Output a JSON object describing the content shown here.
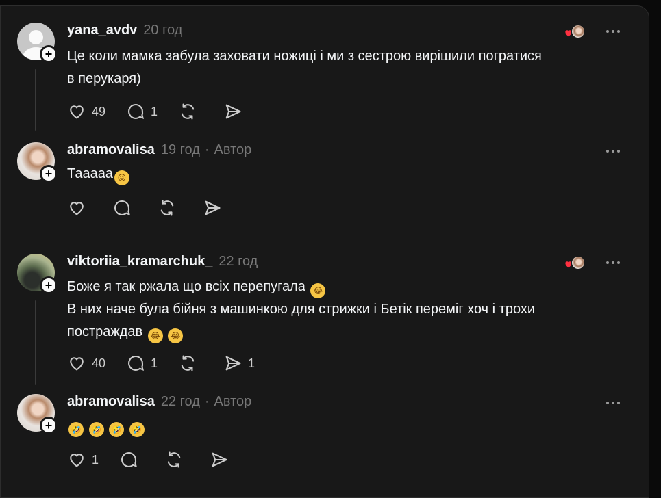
{
  "threads": [
    {
      "post": {
        "username": "yana_avdv",
        "time": "20 год",
        "text_lines": [
          "Це коли мамка забула заховати ножиці і ми з сестрою вирішили погратися",
          "в перукаря)"
        ],
        "likes": "49",
        "replies": "1",
        "reposts": "",
        "shares": ""
      },
      "reply": {
        "username": "abramovalisa",
        "time": "19 год",
        "dot": "·",
        "author": "Автор",
        "text": "Таaааа",
        "likes": "",
        "replies": "",
        "reposts": "",
        "shares": ""
      }
    },
    {
      "post": {
        "username": "viktoriia_kramarchuk_",
        "time": "22 год",
        "text_lines": [
          "Боже я так ржала що всіх перепугала",
          "В них наче була бійня з машинкою для стрижки і Бетік переміг хоч і трохи",
          "постраждав"
        ],
        "likes": "40",
        "replies": "1",
        "reposts": "",
        "shares": "1"
      },
      "reply": {
        "username": "abramovalisa",
        "time": "22 год",
        "dot": "·",
        "author": "Автор",
        "text": "",
        "likes": "1",
        "replies": "",
        "reposts": "",
        "shares": ""
      }
    }
  ],
  "icons": {
    "like": "heart-icon",
    "reply": "comment-icon",
    "repost": "repost-icon",
    "share": "send-icon",
    "more": "more-dots-icon",
    "liked_by": "liked-by-author-icon",
    "follow": "follow-plus-icon"
  },
  "colors": {
    "background": "#181818",
    "text": "#f3f5f7",
    "muted": "#777777",
    "heart": "#ff3040"
  }
}
